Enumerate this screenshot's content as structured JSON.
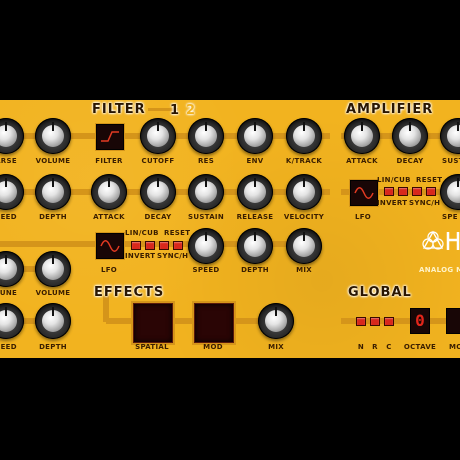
{
  "sections": {
    "filter": "FILTER",
    "filter_pages": [
      "1",
      "2"
    ],
    "amplifier": "AMPLIFIER",
    "effects": "EFFECTS",
    "global": "GLOBAL"
  },
  "osc": {
    "row1": [
      "ARSE",
      "VOLUME"
    ],
    "row2": [
      "PEED",
      "DEPTH"
    ],
    "row3": [
      "TUNE",
      "VOLUME"
    ],
    "row4": [
      "PEED",
      "DEPTH"
    ]
  },
  "filter": {
    "row1": [
      "FILTER",
      "CUTOFF",
      "RES",
      "ENV",
      "K/TRACK"
    ],
    "row2": [
      "ATTACK",
      "DECAY",
      "SUSTAIN",
      "RELEASE",
      "VELOCITY"
    ],
    "row3": [
      "LFO",
      "SPEED",
      "DEPTH",
      "MIX"
    ],
    "lfo": {
      "lin_cub": "LIN/CUB",
      "reset": "RESET",
      "invert": "INVERT",
      "sync": "SYNC/H"
    }
  },
  "amplifier": {
    "row1": [
      "ATTACK",
      "DECAY",
      "SUST"
    ],
    "lfo_label": "LFO",
    "speed_label": "SPE",
    "lfo": {
      "lin_cub": "LIN/CUB",
      "reset": "RESET",
      "invert": "INVERT",
      "sync": "SYNC/H"
    }
  },
  "logo": {
    "text": "ANALOG M"
  },
  "effects": {
    "labels": [
      "SPATIAL",
      "MOD",
      "MIX"
    ]
  },
  "global": {
    "labels": [
      "N",
      "R",
      "C",
      "OCTAVE",
      "MO"
    ],
    "octave_value": "0"
  }
}
